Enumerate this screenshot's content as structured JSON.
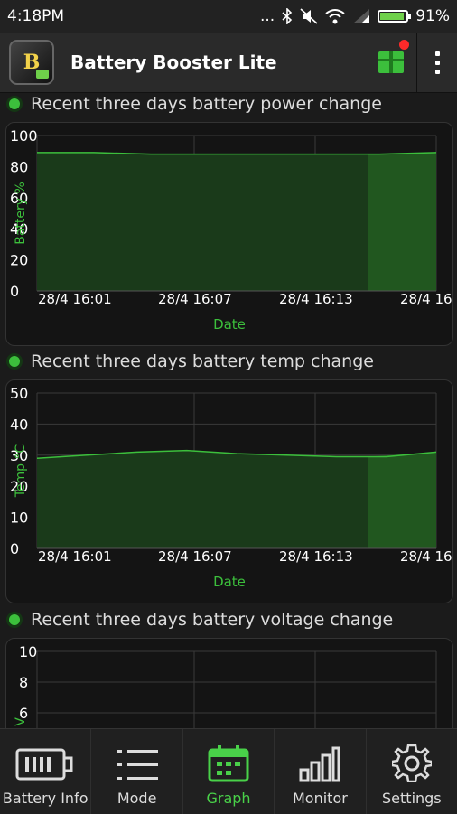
{
  "status_bar": {
    "time": "4:18PM",
    "battery_percent": "91%",
    "battery_level": 0.91,
    "dots": "..."
  },
  "app_bar": {
    "title": "Battery Booster Lite",
    "logo_letter": "B"
  },
  "colors": {
    "accent": "#3cbf3c",
    "chart_fill": "#1a3a1a",
    "highlight_fill": "#21571f",
    "badge": "#ff2a2a"
  },
  "sections": [
    {
      "title": "Recent three days battery power change"
    },
    {
      "title": "Recent three days battery temp change"
    },
    {
      "title": "Recent three days battery voltage change"
    }
  ],
  "chart_data": [
    {
      "type": "area",
      "title": "Recent three days battery power change",
      "xlabel": "Date",
      "ylabel": "Battery %",
      "x": [
        "28/4 16:01",
        "28/4 16:07",
        "28/4 16:13",
        "28/4 16"
      ],
      "yticks": [
        "100",
        "80",
        "60",
        "40",
        "20",
        "0"
      ],
      "ylim": [
        0,
        100
      ],
      "series": [
        {
          "values": [
            89,
            89,
            88,
            88,
            88,
            88,
            88,
            89
          ]
        }
      ],
      "grid": true
    },
    {
      "type": "area",
      "title": "Recent three days battery temp change",
      "xlabel": "Date",
      "ylabel": "Temp °C",
      "x": [
        "28/4 16:01",
        "28/4 16:07",
        "28/4 16:13",
        "28/4 16"
      ],
      "yticks": [
        "50",
        "40",
        "30",
        "20",
        "10",
        "0"
      ],
      "ylim": [
        0,
        50
      ],
      "series": [
        {
          "values": [
            29,
            30,
            31,
            31.5,
            30.5,
            30,
            29.5,
            29.5,
            31
          ]
        }
      ],
      "grid": true
    },
    {
      "type": "area",
      "title": "Recent three days battery voltage change",
      "xlabel": "",
      "ylabel": "V",
      "yticks": [
        "10",
        "8",
        "6"
      ],
      "ylim": [
        0,
        10
      ],
      "grid": true
    }
  ],
  "bottom_nav": [
    {
      "label": "Battery Info",
      "icon": "battery-icon"
    },
    {
      "label": "Mode",
      "icon": "list-icon"
    },
    {
      "label": "Graph",
      "icon": "calendar-graph-icon",
      "active": true
    },
    {
      "label": "Monitor",
      "icon": "bar-chart-icon"
    },
    {
      "label": "Settings",
      "icon": "gear-icon"
    }
  ]
}
